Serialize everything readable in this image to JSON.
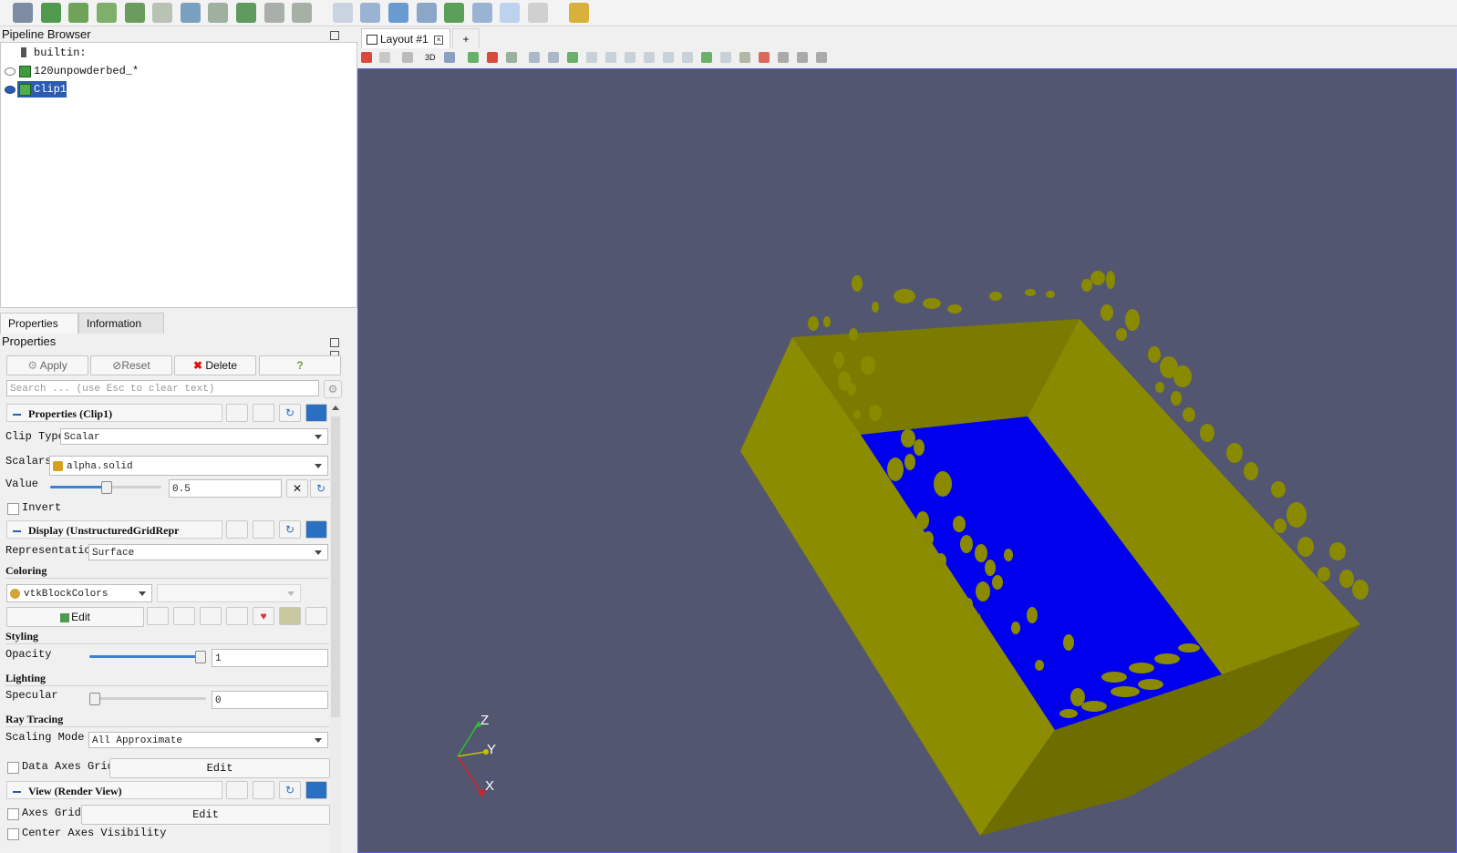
{
  "pipeline_browser": {
    "title": "Pipeline Browser",
    "items": [
      {
        "label": "builtin:"
      },
      {
        "label": "120unpowderbed_*"
      },
      {
        "label": "Clip1"
      }
    ]
  },
  "tabs": {
    "properties": "Properties",
    "information": "Information"
  },
  "properties_panel": {
    "title": "Properties",
    "apply": "Apply",
    "reset": "Reset",
    "delete": "Delete",
    "help": "?",
    "search_placeholder": "Search ... (use Esc to clear text)"
  },
  "sections": {
    "properties": "Properties (Clip1)",
    "display": "Display (UnstructuredGridRepr",
    "view": "View (Render View)"
  },
  "clip": {
    "clip_type_label": "Clip Type",
    "clip_type_value": "Scalar",
    "scalars_label": "Scalars",
    "scalars_value": "alpha.solid",
    "value_label": "Value",
    "value": "0.5",
    "value_slider": 0.5,
    "invert_label": "Invert"
  },
  "display": {
    "representation_label": "Representation",
    "representation_value": "Surface",
    "coloring_label": "Coloring",
    "coloring_value": "vtkBlockColors",
    "edit_label": "Edit",
    "styling_label": "Styling",
    "opacity_label": "Opacity",
    "opacity_value": "1",
    "lighting_label": "Lighting",
    "specular_label": "Specular",
    "specular_value": "0",
    "ray_tracing_label": "Ray Tracing",
    "scaling_mode_label": "Scaling Mode",
    "scaling_mode_value": "All Approximate",
    "data_axes_grid_label": "Data Axes Grid",
    "data_axes_grid_edit": "Edit"
  },
  "view": {
    "axes_grid_label": "Axes Grid",
    "axes_grid_edit": "Edit",
    "center_axes_label": "Center Axes Visibility"
  },
  "layout": {
    "tab_label": "Layout #1",
    "add_tab": "+"
  },
  "view_toolbar": {
    "mode_3d": "3D"
  },
  "axes_triad": {
    "z": "Z",
    "y": "Y",
    "x": "X"
  },
  "colors": {
    "viewport_bg": "#525671",
    "box_yellow": "#8a8a00",
    "surface_blue": "#0000ee",
    "selection": "#2a5db0"
  }
}
